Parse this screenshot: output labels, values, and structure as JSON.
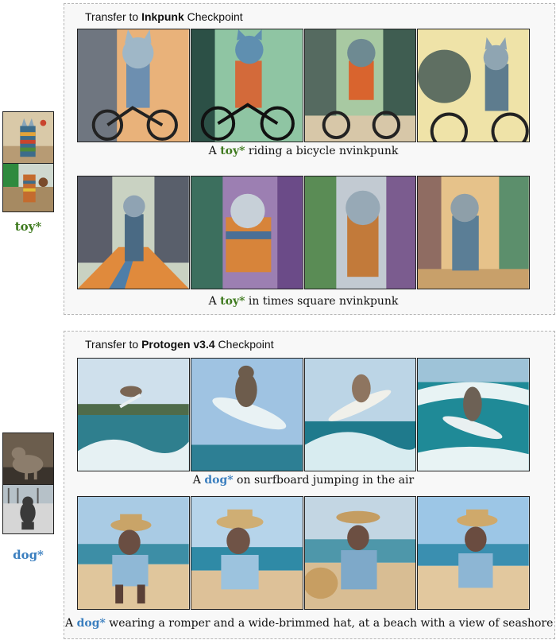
{
  "colors": {
    "toy_token": "#3e7a1e",
    "dog_token": "#3b7fbf"
  },
  "left": {
    "toy": {
      "label": "toy*"
    },
    "dog": {
      "label": "dog*"
    }
  },
  "panels": [
    {
      "title_prefix": "Transfer to ",
      "title_bold": "Inkpunk",
      "title_suffix": " Checkpoint",
      "rows": [
        {
          "caption": {
            "pre": "A ",
            "token": "toy*",
            "post": " riding a bicycle nvinkpunk"
          }
        },
        {
          "caption": {
            "pre": "A ",
            "token": "toy*",
            "post": " in times square nvinkpunk"
          }
        }
      ]
    },
    {
      "title_prefix": "Transfer to ",
      "title_bold": "Protogen v3.4",
      "title_suffix": " Checkpoint",
      "rows": [
        {
          "caption": {
            "pre": "A ",
            "token": "dog*",
            "post": " on surfboard jumping in the air"
          }
        },
        {
          "caption": {
            "pre": "A ",
            "token": "dog*",
            "post": " wearing a romper and a wide-brimmed hat, at a beach with a view of seashore"
          }
        }
      ]
    }
  ]
}
